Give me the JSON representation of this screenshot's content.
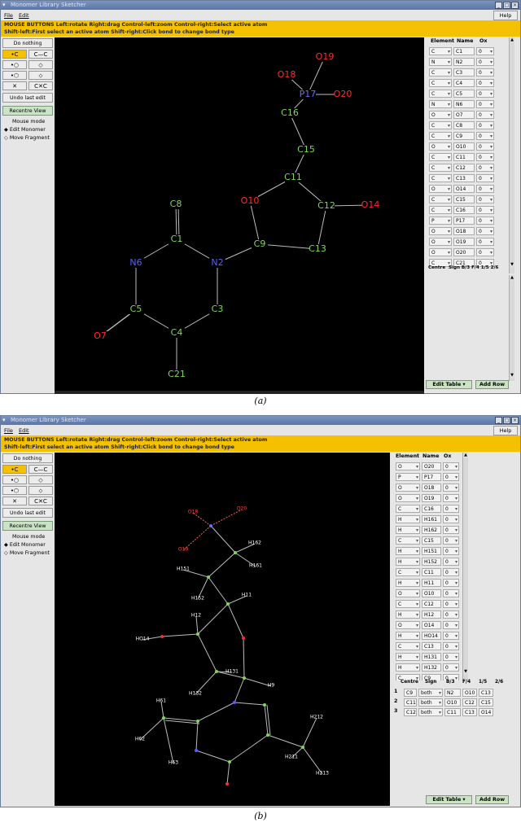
{
  "window_title": "Monomer Library Sketcher",
  "menu": {
    "file": "File",
    "edit": "Edit",
    "help": "Help"
  },
  "info_line1": "MOUSE BUTTONS Left:rotate Right:drag Control-left:zoom    Control-right:Select active atom",
  "info_line2": "Shift-left:First select an active atom Shift-right:Click bond to change bond type",
  "left_panel": {
    "do_nothing": "Do nothing",
    "undo": "Undo last edit",
    "recentre": "Recentre View",
    "mouse_mode": "Mouse mode",
    "edit_monomer": "Edit Monomer",
    "move_fragment": "Move Fragment"
  },
  "table_headers": {
    "element": "Element",
    "name": "Name",
    "ox": "Ox"
  },
  "panel_a_rows": [
    [
      "C",
      "C1",
      "0"
    ],
    [
      "N",
      "N2",
      "0"
    ],
    [
      "C",
      "C3",
      "0"
    ],
    [
      "C",
      "C4",
      "0"
    ],
    [
      "C",
      "C5",
      "0"
    ],
    [
      "N",
      "N6",
      "0"
    ],
    [
      "O",
      "O7",
      "0"
    ],
    [
      "C",
      "C8",
      "0"
    ],
    [
      "C",
      "C9",
      "0"
    ],
    [
      "O",
      "O10",
      "0"
    ],
    [
      "C",
      "C11",
      "0"
    ],
    [
      "C",
      "C12",
      "0"
    ],
    [
      "C",
      "C13",
      "0"
    ],
    [
      "O",
      "O14",
      "0"
    ],
    [
      "C",
      "C15",
      "0"
    ],
    [
      "C",
      "C16",
      "0"
    ],
    [
      "P",
      "P17",
      "0"
    ],
    [
      "O",
      "O18",
      "0"
    ],
    [
      "O",
      "O19",
      "0"
    ],
    [
      "O",
      "O20",
      "0"
    ],
    [
      "C",
      "C21",
      "0"
    ]
  ],
  "panel_b_rows": [
    [
      "O",
      "O20",
      "0"
    ],
    [
      "P",
      "P17",
      "0"
    ],
    [
      "O",
      "O18",
      "0"
    ],
    [
      "O",
      "O19",
      "0"
    ],
    [
      "C",
      "C16",
      "0"
    ],
    [
      "H",
      "H161",
      "0"
    ],
    [
      "H",
      "H162",
      "0"
    ],
    [
      "C",
      "C15",
      "0"
    ],
    [
      "H",
      "H151",
      "0"
    ],
    [
      "H",
      "H152",
      "0"
    ],
    [
      "C",
      "C11",
      "0"
    ],
    [
      "H",
      "H11",
      "0"
    ],
    [
      "O",
      "O10",
      "0"
    ],
    [
      "C",
      "C12",
      "0"
    ],
    [
      "H",
      "H12",
      "0"
    ],
    [
      "O",
      "O14",
      "0"
    ],
    [
      "H",
      "HO14",
      "0"
    ],
    [
      "C",
      "C13",
      "0"
    ],
    [
      "H",
      "H131",
      "0"
    ],
    [
      "H",
      "H132",
      "0"
    ],
    [
      "C",
      "C9",
      "0"
    ]
  ],
  "centre_headers": [
    "Centre",
    "Sign",
    "B/3",
    "F/4",
    "1/5",
    "2/6"
  ],
  "centre_rows": [
    [
      "1",
      "C9",
      "both",
      "N2",
      "O10",
      "C13"
    ],
    [
      "2",
      "C11",
      "both",
      "O10",
      "C12",
      "C15"
    ],
    [
      "3",
      "C12",
      "both",
      "C11",
      "C13",
      "O14"
    ]
  ],
  "bottom": {
    "edit_table": "Edit Table",
    "add_row": "Add Row"
  },
  "caption_a": "(a)",
  "caption_b": "(b)",
  "colors": {
    "carbon": "#7fd65a",
    "nitrogen": "#5560ff",
    "oxygen": "#ff2a2a",
    "phosphorus": "#6a6aff",
    "bond": "#c8c8c8",
    "toolbar_highlight": "#f4c000"
  },
  "atoms_a": [
    {
      "label": "C8",
      "el": "C"
    },
    {
      "label": "C1",
      "el": "C"
    },
    {
      "label": "N6",
      "el": "N"
    },
    {
      "label": "N2",
      "el": "N"
    },
    {
      "label": "C5",
      "el": "C"
    },
    {
      "label": "C3",
      "el": "C"
    },
    {
      "label": "C4",
      "el": "C"
    },
    {
      "label": "O7",
      "el": "O"
    },
    {
      "label": "C21",
      "el": "C"
    },
    {
      "label": "C9",
      "el": "C"
    },
    {
      "label": "O10",
      "el": "O"
    },
    {
      "label": "C11",
      "el": "C"
    },
    {
      "label": "C12",
      "el": "C"
    },
    {
      "label": "C13",
      "el": "C"
    },
    {
      "label": "O14",
      "el": "O"
    },
    {
      "label": "C15",
      "el": "C"
    },
    {
      "label": "C16",
      "el": "C"
    },
    {
      "label": "P17",
      "el": "P"
    },
    {
      "label": "O18",
      "el": "O"
    },
    {
      "label": "O19",
      "el": "O"
    },
    {
      "label": "O20",
      "el": "O"
    }
  ],
  "labels_b": [
    "O18",
    "O20",
    "O19",
    "H162",
    "H161",
    "H151",
    "H152",
    "H11",
    "H12",
    "HO14",
    "H131",
    "H132",
    "H9",
    "H61",
    "H62",
    "H63",
    "H212",
    "H211",
    "H213"
  ]
}
